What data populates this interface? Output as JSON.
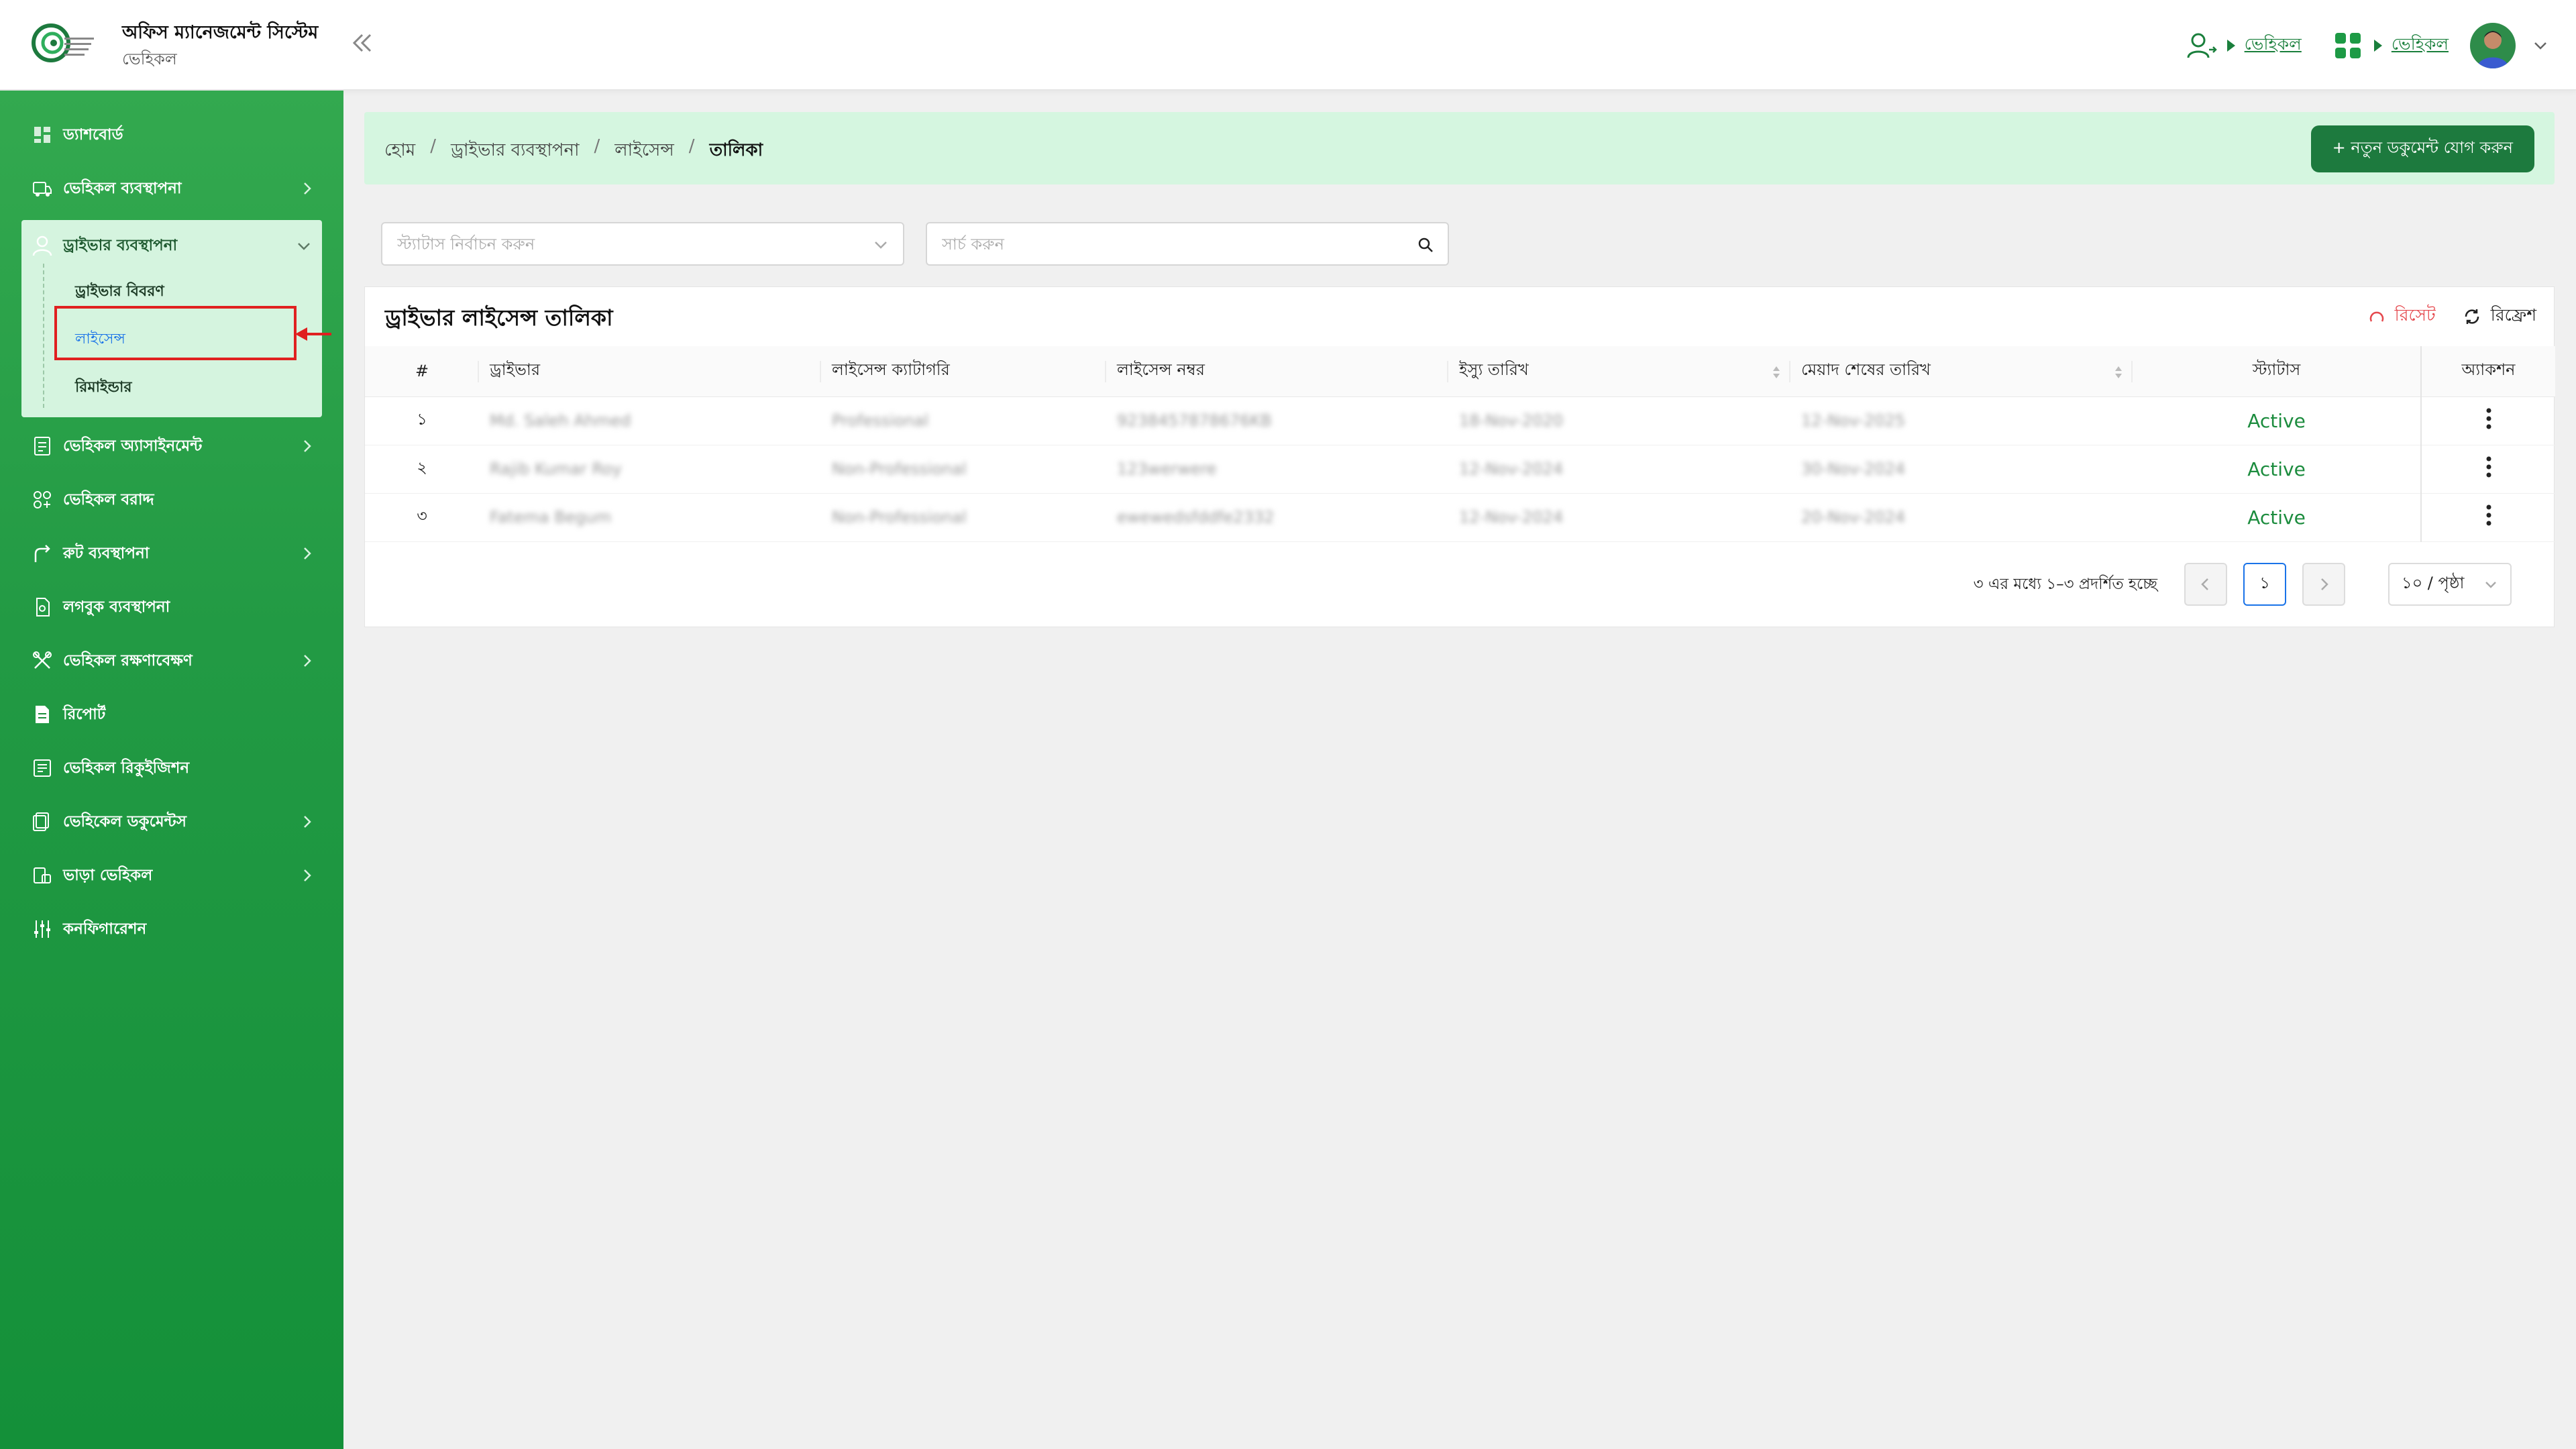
{
  "header": {
    "app_title": "অফিস ম্যানেজমেন্ট সিস্টেম",
    "app_subtitle": "ভেহিকল",
    "link_one": "ভেহিকল",
    "link_two": "ভেহিকল"
  },
  "sidebar": {
    "items": [
      {
        "label": "ড্যাশবোর্ড",
        "icon": "dashboard-icon"
      },
      {
        "label": "ভেহিকল ব্যবস্থাপনা",
        "icon": "car-icon"
      },
      {
        "label": "ড্রাইভার ব্যবস্থাপনা",
        "icon": "driver-icon"
      },
      {
        "label": "ভেহিকল অ্যাসাইনমেন্ট",
        "icon": "assignment-icon"
      },
      {
        "label": "ভেহিকল বরাদ্দ",
        "icon": "allocation-icon"
      },
      {
        "label": "রুট ব্যবস্থাপনা",
        "icon": "route-icon"
      },
      {
        "label": "লগবুক ব্যবস্থাপনা",
        "icon": "logbook-icon"
      },
      {
        "label": "ভেহিকল রক্ষণাবেক্ষণ",
        "icon": "maintenance-icon"
      },
      {
        "label": "রিপোর্ট",
        "icon": "report-icon"
      },
      {
        "label": "ভেহিকল রিকুইজিশন",
        "icon": "requisition-icon"
      },
      {
        "label": "ভেহিকেল ডকুমেন্টস",
        "icon": "documents-icon"
      },
      {
        "label": "ভাড়া ভেহিকল",
        "icon": "rental-icon"
      },
      {
        "label": "কনফিগারেশন",
        "icon": "config-icon"
      }
    ],
    "sub_items": [
      "ড্রাইভার বিবরণ",
      "লাইসেন্স",
      "রিমাইন্ডার"
    ]
  },
  "breadcrumb": {
    "home": "হোম",
    "level1": "ড্রাইভার ব্যবস্থাপনা",
    "level2": "লাইসেন্স",
    "current": "তালিকা",
    "sep": "/"
  },
  "add_button": "+ নতুন ডকুমেন্ট যোগ করুন",
  "filters": {
    "status_placeholder": "স্ট্যাটাস নির্বাচন করুন",
    "search_placeholder": "সার্চ করুন"
  },
  "table_card": {
    "title": "ড্রাইভার লাইসেন্স তালিকা",
    "reset": "রিসেট",
    "refresh": "রিফ্রেশ",
    "columns": [
      "#",
      "ড্রাইভার",
      "লাইসেন্স ক্যাটাগরি",
      "লাইসেন্স নম্বর",
      "ইস্যু তারিখ",
      "মেয়াদ শেষের তারিখ",
      "স্ট্যাটাস",
      "অ্যাকশন"
    ],
    "rows": [
      {
        "num": "১",
        "driver": "Md. Saleh Ahmed",
        "category": "Professional",
        "license": "9238457878676KB",
        "issue": "18-Nov-2020",
        "expiry": "12-Nov-2025",
        "status": "Active"
      },
      {
        "num": "২",
        "driver": "Rajib Kumar Roy",
        "category": "Non-Professional",
        "license": "123werwere",
        "issue": "12-Nov-2024",
        "expiry": "30-Nov-2024",
        "status": "Active"
      },
      {
        "num": "৩",
        "driver": "Fatema Begum",
        "category": "Non-Professional",
        "license": "ewewedsfddfe2332",
        "issue": "12-Nov-2024",
        "expiry": "20-Nov-2024",
        "status": "Active"
      }
    ]
  },
  "pagination": {
    "summary": "৩ এর মধ্যে ১–৩ প্রদর্শিত হচ্ছে",
    "current_page": "১",
    "page_size": "১০ / পৃষ্ঠা"
  },
  "colors": {
    "primary": "#1d7a3e",
    "sidebar_top": "#33a94f",
    "sidebar_bottom": "#149039",
    "breadcrumb_bg": "#d5f6e0",
    "status_active": "#1c8c3e",
    "reset": "#e5484d",
    "highlight": "#e02020"
  }
}
